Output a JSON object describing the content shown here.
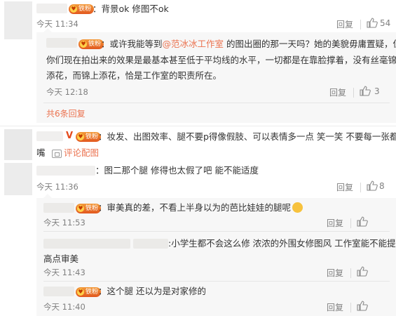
{
  "comments": [
    {
      "badge": "铁粉",
      "text": "：背景ok 修图不ok",
      "time": "今天 11:34",
      "reply": "回复",
      "likes": "54",
      "replies": [
        {
          "badge": "铁粉",
          "text_pre": "：或许我能等到",
          "mention": "@范冰冰工作室",
          "text_post": " 的图出圈的那一天吗？她的美貌毋庸置疑，但",
          "line2": "你们现在拍出来的效果是最基本甚至低于平均线的水平，一切都是在靠脸撑着，没有丝毫锦上",
          "line3": "添花，而锦上添花，恰是工作室的职责所在。",
          "time": "今天 12:18",
          "reply": "回复",
          "likes": "3"
        }
      ],
      "more": "共6条回复"
    },
    {
      "verified": "V",
      "badge": "铁粉",
      "text": "：妆发、出图效率、腿不要p得像假肢、可以表情多一点 笑一笑 不要每一张都撅",
      "line2": "嘴",
      "image_link": "评论配图"
    },
    {
      "text": "：图二那个腿 修得也太假了吧 能不能适度",
      "time": "今天 11:36",
      "reply": "回复",
      "likes": "8",
      "replies": [
        {
          "badge": "铁粉",
          "text": "：审美真的差，不看上半身以为的芭比娃娃的腿呢",
          "time": "今天 11:53",
          "reply": "回复"
        },
        {
          "text": ":小学生都不会这么修 浓浓的外围女修图风 工作室能不能提",
          "line2": "高点审美",
          "time": "今天 11:43",
          "reply": "回复"
        },
        {
          "badge": "铁粉",
          "text": "：这个腿 还以为是对家修的",
          "time": "今天 11:40",
          "reply": "回复"
        }
      ]
    }
  ],
  "colors": {
    "link": "#eb7350",
    "meta": "#808080",
    "panel": "#f2f2f5",
    "badge": "#e2581f"
  },
  "icons": {
    "like": "thumbs-up-icon",
    "image": "image-icon",
    "verified": "verified-v-icon",
    "emoji": "laughing-emoji-icon"
  }
}
